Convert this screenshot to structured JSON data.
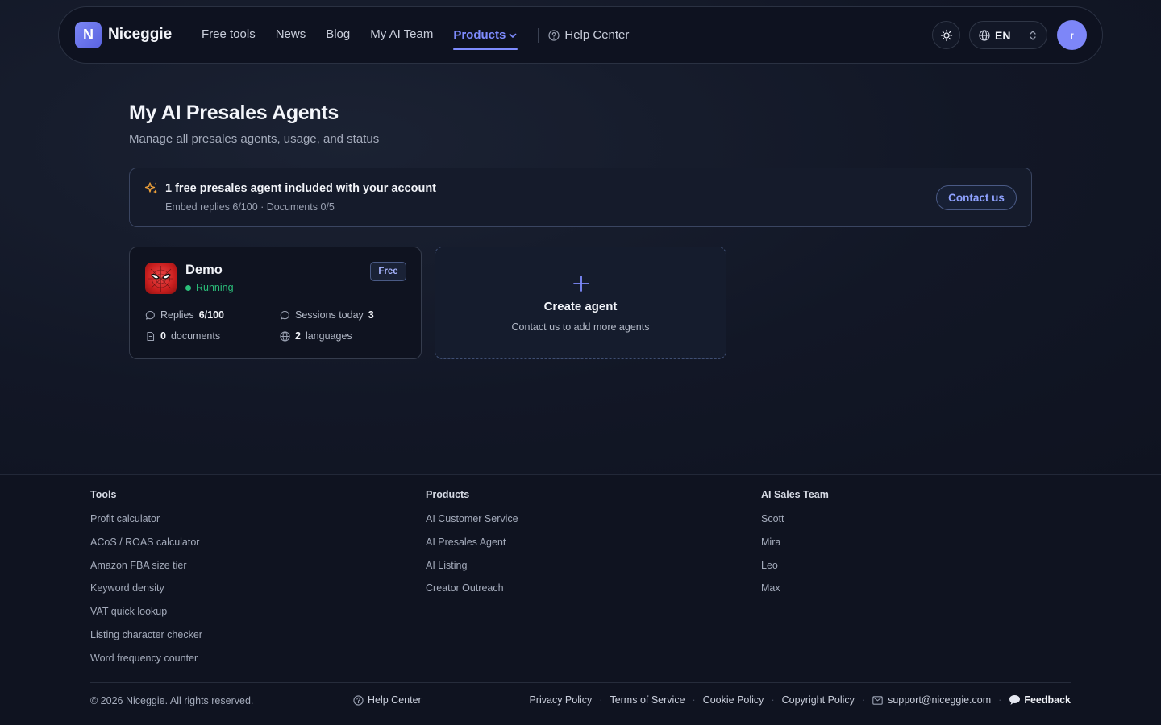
{
  "header": {
    "logo_letter": "N",
    "brand": "Niceggie",
    "nav": [
      {
        "label": "Free tools"
      },
      {
        "label": "News"
      },
      {
        "label": "Blog"
      },
      {
        "label": "My AI Team"
      },
      {
        "label": "Products"
      }
    ],
    "help_label": "Help Center",
    "language": "EN",
    "avatar_initial": "r",
    "active_nav": "Products"
  },
  "main": {
    "title": "My AI Presales Agents",
    "subtitle": "Manage all presales agents, usage, and status",
    "banner": {
      "title": "1 free presales agent included with your account",
      "subtitle": "Embed replies 6/100 · Documents 0/5",
      "button": "Contact us"
    },
    "agent": {
      "name": "Demo",
      "status": "Running",
      "badge": "Free",
      "replies_label": "Replies",
      "replies_value": "6/100",
      "sessions_label": "Sessions today",
      "sessions_value": "3",
      "documents_value": "0",
      "documents_label": "documents",
      "languages_value": "2",
      "languages_label": "languages"
    },
    "create": {
      "title": "Create agent",
      "subtitle": "Contact us to add more agents"
    }
  },
  "footer": {
    "columns": [
      {
        "heading": "Tools",
        "items": [
          "Profit calculator",
          "ACoS / ROAS calculator",
          "Amazon FBA size tier",
          "Keyword density",
          "VAT quick lookup",
          "Listing character checker",
          "Word frequency counter"
        ]
      },
      {
        "heading": "Products",
        "items": [
          "AI Customer Service",
          "AI Presales Agent",
          "AI Listing",
          "Creator Outreach"
        ]
      },
      {
        "heading": "AI Sales Team",
        "items": [
          "Scott",
          "Mira",
          "Leo",
          "Max"
        ]
      }
    ],
    "copyright": "© 2026 Niceggie. All rights reserved.",
    "help": "Help Center",
    "links": [
      "Privacy Policy",
      "Terms of Service",
      "Cookie Policy",
      "Copyright Policy"
    ],
    "email": "support@niceggie.com",
    "feedback": "Feedback"
  },
  "colors": {
    "accent": "#7f8cff",
    "status_green": "#2bbf7a",
    "background": "#0f1320"
  }
}
